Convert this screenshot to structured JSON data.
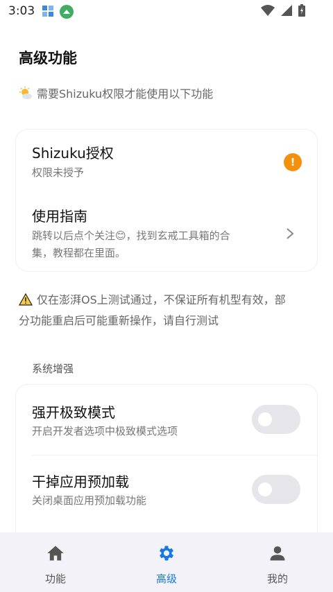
{
  "status_bar": {
    "time": "3:03"
  },
  "page": {
    "title": "高级功能",
    "notice": "需要Shizuku权限才能使用以下功能"
  },
  "auth_card": {
    "shizuku": {
      "title": "Shizuku授权",
      "subtitle": "权限未授予",
      "badge": "!"
    },
    "guide": {
      "title": "使用指南",
      "subtitle_line1": "跳转以后点个关注😊，找到玄戒工具箱的合",
      "subtitle_line2": "集，教程都在里面。"
    }
  },
  "warning": {
    "line1": "仅在澎湃OS上测试通过，不保证所有机型有效，部",
    "line2": "分功能重启后可能重新操作，请自行测试"
  },
  "system_section": {
    "label": "系统增强",
    "items": [
      {
        "title": "强开极致模式",
        "subtitle": "开启开发者选项中极致模式选项",
        "enabled": false
      },
      {
        "title": "干掉应用预加载",
        "subtitle": "关闭桌面应用预加载功能",
        "enabled": false
      }
    ]
  },
  "bottom_nav": {
    "items": [
      {
        "label": "功能",
        "icon": "home-icon"
      },
      {
        "label": "高级",
        "icon": "gear-icon",
        "active": true
      },
      {
        "label": "我的",
        "icon": "person-icon"
      }
    ]
  },
  "colors": {
    "accent": "#1677e5",
    "badge": "#f5900c",
    "toggle_off": "#e5e5ea",
    "nav_bg": "#f3f2f8"
  }
}
